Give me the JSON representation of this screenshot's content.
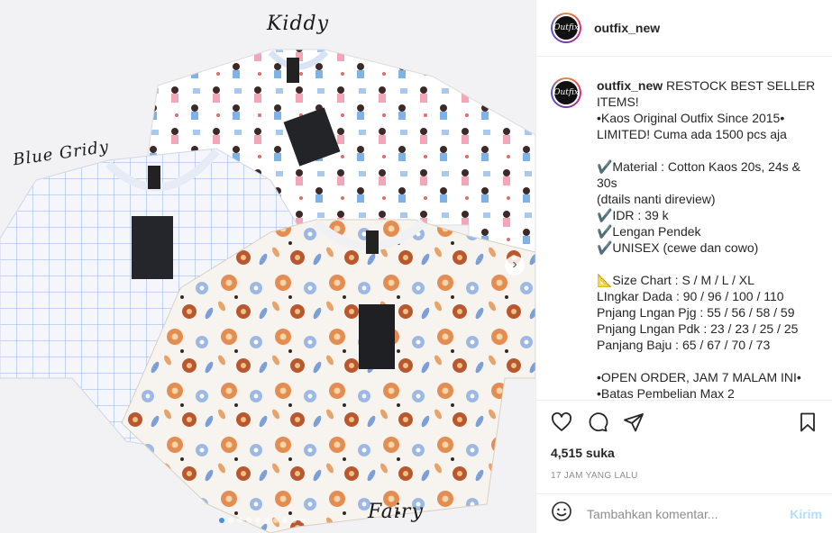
{
  "media": {
    "labels": {
      "kiddy": "Kiddy",
      "blue_gridy": "Blue Gridy",
      "fairy": "Fairy"
    },
    "carousel": {
      "slide_count": 10,
      "active_index": 0
    },
    "next_icon": "chevron-right-icon"
  },
  "header": {
    "username": "outfix_new",
    "avatar_text": "Outfix"
  },
  "caption": {
    "username": "outfix_new",
    "first_line": " RESTOCK BEST SELLER ITEMS!",
    "lines": [
      "•Kaos Original Outfix Since 2015•",
      "LIMITED! Cuma ada 1500 pcs aja",
      "",
      "✔️Material : Cotton Kaos 20s, 24s & 30s",
      "(dtails nanti direview)",
      "✔️IDR : 39 k",
      "✔️Lengan Pendek",
      "✔️UNISEX (cewe dan cowo)",
      "",
      "📐Size Chart : S / M / L / XL",
      "LIngkar Dada : 90 / 96 / 100 / 110",
      "Pnjang Lngan Pjg : 55 / 56 / 58 / 59",
      "Pnjang Lngan Pdk : 23 / 23 / 25 / 25",
      "Panjang Baju : 65 / 67 / 70 / 73",
      "",
      "•OPEN ORDER, JAM 7 MALAM INI•",
      "•Batas Pembelian Max 2"
    ]
  },
  "actions": {
    "icons": [
      "heart-icon",
      "comment-icon",
      "share-icon",
      "bookmark-icon"
    ],
    "likes": "4,515 suka",
    "timestamp": "17 JAM YANG LALU"
  },
  "comment": {
    "placeholder": "Tambahkan komentar...",
    "post_label": "Kirim",
    "emoji_icon": "emoji-icon"
  },
  "colors": {
    "accent_disabled": "#b2dffc",
    "text": "#262626",
    "muted": "#8e8e8e",
    "carousel_active": "#4a90d9"
  }
}
